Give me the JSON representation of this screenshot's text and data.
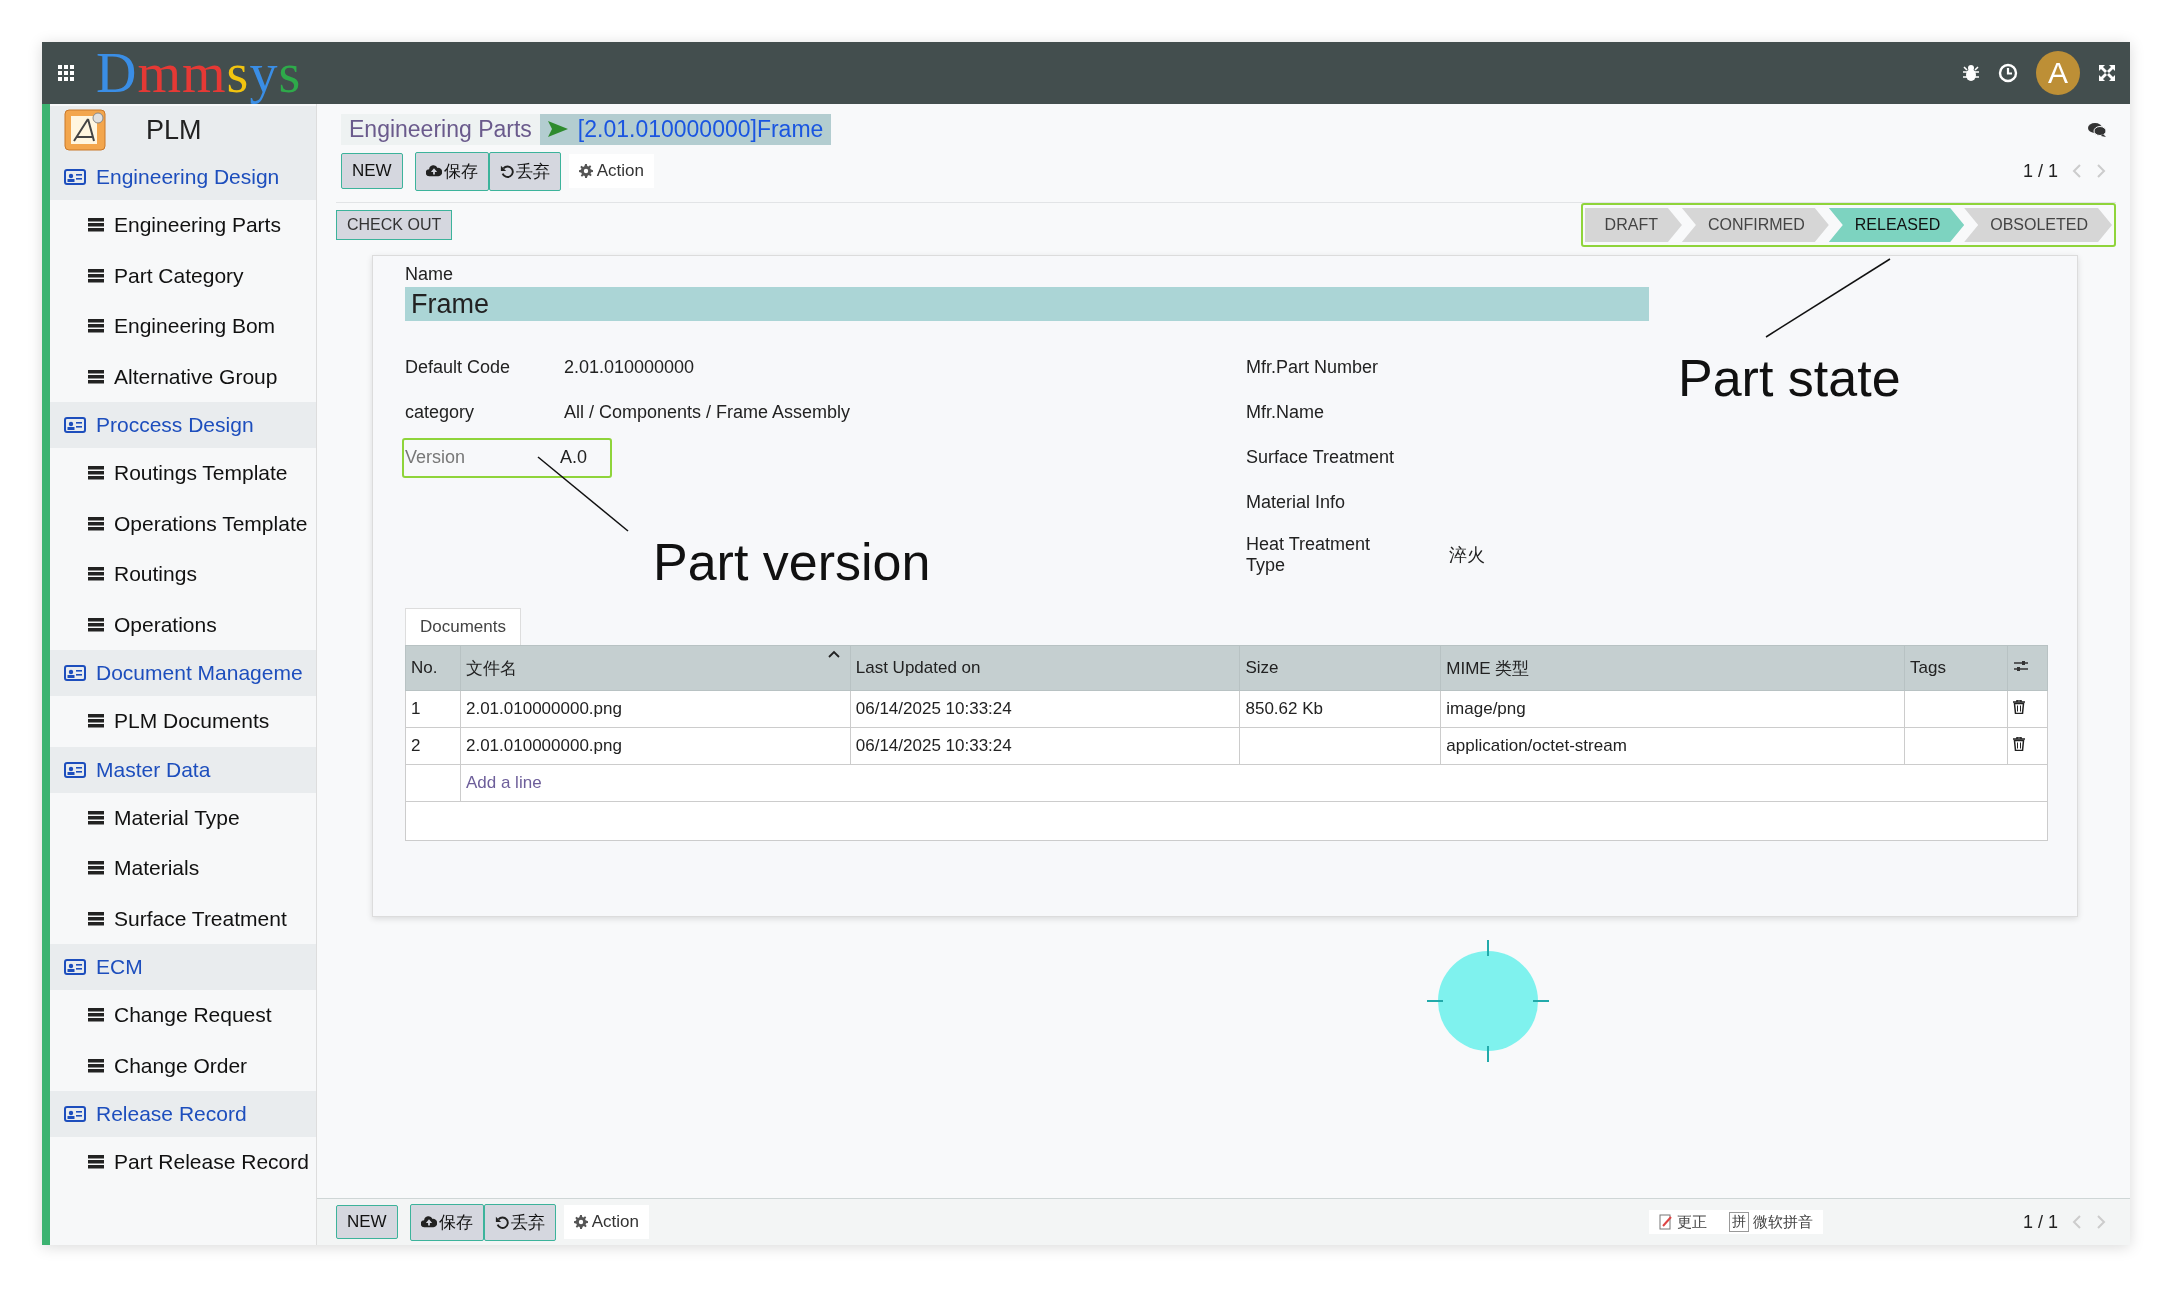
{
  "topbar": {
    "logo": "Dmmsys",
    "avatar": "A"
  },
  "sidebar": {
    "app": "PLM",
    "sections": [
      {
        "label": "Engineering Design",
        "children": [
          {
            "label": "Engineering Parts"
          },
          {
            "label": "Part Category"
          },
          {
            "label": "Engineering Bom"
          },
          {
            "label": "Alternative Group"
          }
        ]
      },
      {
        "label": "Proccess Design",
        "children": [
          {
            "label": "Routings Template"
          },
          {
            "label": "Operations Template"
          },
          {
            "label": "Routings"
          },
          {
            "label": "Operations"
          }
        ]
      },
      {
        "label": "Document Manageme",
        "children": [
          {
            "label": "PLM Documents"
          }
        ]
      },
      {
        "label": "Master Data",
        "children": [
          {
            "label": "Material Type"
          },
          {
            "label": "Materials"
          },
          {
            "label": "Surface Treatment"
          }
        ]
      },
      {
        "label": "ECM",
        "children": [
          {
            "label": "Change Request"
          },
          {
            "label": "Change Order"
          }
        ]
      },
      {
        "label": "Release Record",
        "children": [
          {
            "label": "Part Release Record"
          }
        ]
      }
    ]
  },
  "breadcrumb": [
    "Engineering Parts",
    "[2.01.010000000]Frame"
  ],
  "toolbar": {
    "new": "NEW",
    "save": "保存",
    "discard": "丢弃",
    "action": "Action",
    "pager": "1 / 1"
  },
  "check_out": "CHECK OUT",
  "states": [
    {
      "label": "DRAFT",
      "selected": false
    },
    {
      "label": "CONFIRMED",
      "selected": false
    },
    {
      "label": "RELEASED",
      "selected": true
    },
    {
      "label": "OBSOLETED",
      "selected": false
    }
  ],
  "form": {
    "name_label": "Name",
    "name_value": "Frame",
    "left_fields": [
      {
        "label": "Default Code",
        "value": "2.01.010000000",
        "highlighted": false
      },
      {
        "label": "category",
        "value": "All / Components / Frame Assembly",
        "highlighted": false
      },
      {
        "label": "Version",
        "value": "A.0",
        "highlighted": true
      }
    ],
    "right_fields": [
      {
        "label": "Mfr.Part Number"
      },
      {
        "label": "Mfr.Name"
      },
      {
        "label": "Surface Treatment"
      },
      {
        "label": "Material Info"
      },
      {
        "label": "Heat Treatment Type",
        "value": "淬火"
      }
    ]
  },
  "annotations": [
    {
      "text": "Part version"
    },
    {
      "text": "Part state"
    }
  ],
  "documents": {
    "tab": "Documents",
    "columns": [
      "No.",
      "文件名",
      "Last Updated on",
      "Size",
      "MIME 类型",
      "Tags"
    ],
    "rows": [
      [
        "1",
        "2.01.010000000.png",
        "06/14/2025 10:33:24",
        "850.62 Kb",
        "image/png",
        ""
      ],
      [
        "2",
        "2.01.010000000.png",
        "06/14/2025 10:33:24",
        "",
        "application/octet-stream",
        ""
      ]
    ],
    "add_line": "Add a line"
  },
  "bottom_bar": {
    "new": "NEW",
    "save": "保存",
    "discard": "丢弃",
    "action": "Action",
    "ime_correct": "更正",
    "ime_mode": "拼",
    "ime_name": "微软拼音",
    "pager": "1 / 1"
  }
}
